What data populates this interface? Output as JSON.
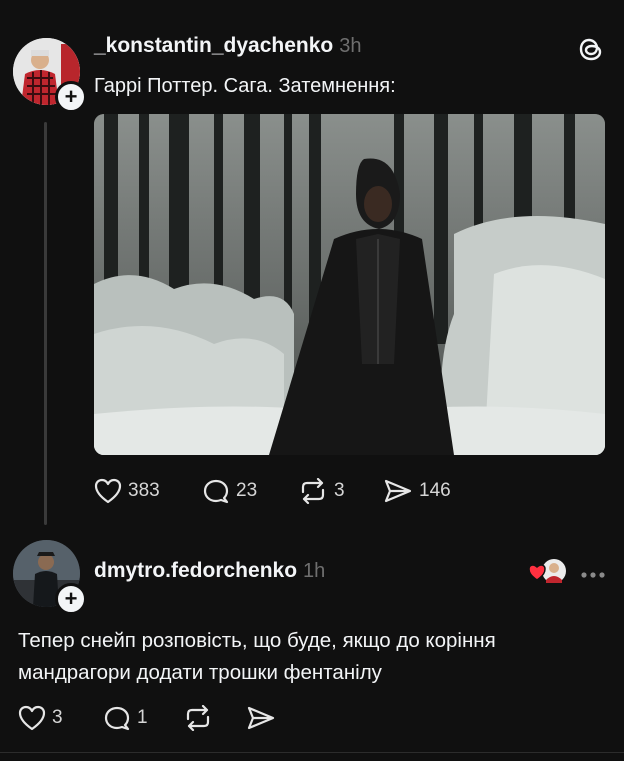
{
  "post": {
    "username": "_konstantin_dyachenko",
    "time": "3h",
    "text": "Гаррі Поттер. Сага. Затемнення:",
    "likes": "383",
    "replies": "23",
    "reposts": "3",
    "shares": "146"
  },
  "reply": {
    "username": "dmytro.fedorchenko",
    "time": "1h",
    "text_line1": "Тепер снейп розповість, що буде, якщо до коріння",
    "text_line2": "мандрагори додати трошки фентанілу",
    "likes": "3",
    "replies": "1"
  },
  "icons": [
    "threads-logo-icon",
    "plus-icon",
    "heart-icon",
    "comment-icon",
    "repost-icon",
    "share-icon",
    "more-icon",
    "liked-avatar-icon"
  ],
  "colors": {
    "background": "#101010",
    "text": "#f3f5f7",
    "muted": "#6f6f6f",
    "like_red": "#ff3040"
  }
}
